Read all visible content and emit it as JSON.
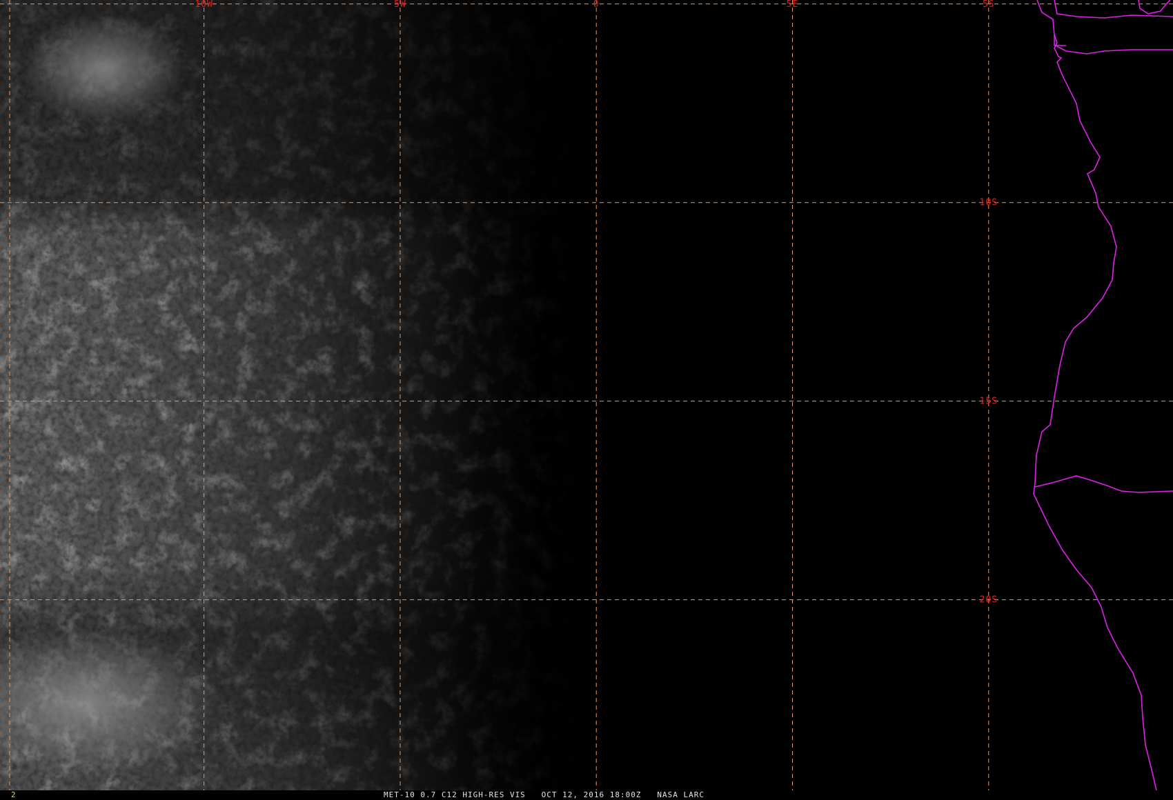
{
  "map": {
    "lon_labels": [
      "10W",
      "5W",
      "0",
      "5E"
    ],
    "lat_labels": [
      "5S",
      "10S",
      "15S",
      "20S"
    ],
    "grid_color": "#e89a62",
    "label_color": "#e02020",
    "coastline_color": "#e020e8",
    "lon_range_deg": [
      -15.2,
      14.7
    ],
    "lat_range_deg": [
      -4.9,
      -24.8
    ]
  },
  "status": {
    "frame_number": "2",
    "product": "MET-10 0.7 C12 HIGH-RES VIS   OCT 12, 2016 18:00Z   NASA LARC"
  }
}
